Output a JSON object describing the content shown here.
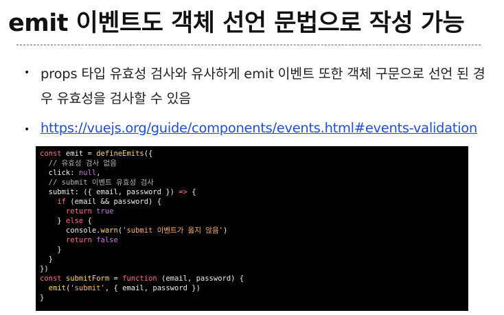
{
  "slide": {
    "title": "emit 이벤트도 객체 선언 문법으로 작성 가능",
    "bullets": [
      {
        "marker": "•",
        "text": "props 타입 유효성 검사와 유사하게 emit 이벤트 또한 객체 구문으로 선언 된 경우 유효성을 검사할 수 있음"
      },
      {
        "marker": "•",
        "link": "https://vuejs.org/guide/components/events.html#events-validation"
      }
    ]
  },
  "code": {
    "lines": [
      [
        [
          "kw",
          "const"
        ],
        [
          "pl",
          " emit = "
        ],
        [
          "fn",
          "defineEmits"
        ],
        [
          "pl",
          "({"
        ]
      ],
      [
        [
          "cm",
          "  // 유효성 검사 없음"
        ]
      ],
      [
        [
          "pl",
          "  click: "
        ],
        [
          "nul",
          "null"
        ],
        [
          "pl",
          ","
        ]
      ],
      [
        [
          "cm",
          "  // submit 이벤트 유효성 검사"
        ]
      ],
      [
        [
          "pl",
          "  submit: ({ email, password }) "
        ],
        [
          "kw",
          "=>"
        ],
        [
          "pl",
          " {"
        ]
      ],
      [
        [
          "kw",
          "    if"
        ],
        [
          "pl",
          " (email && password) {"
        ]
      ],
      [
        [
          "kw",
          "      return"
        ],
        [
          "pl",
          " "
        ],
        [
          "bool",
          "true"
        ]
      ],
      [
        [
          "pl",
          "    } "
        ],
        [
          "kw",
          "else"
        ],
        [
          "pl",
          " {"
        ]
      ],
      [
        [
          "pl",
          "      console."
        ],
        [
          "fn",
          "warn"
        ],
        [
          "pl",
          "("
        ],
        [
          "str",
          "'submit 이벤트가 옳지 않음'"
        ],
        [
          "pl",
          ")"
        ]
      ],
      [
        [
          "kw",
          "      return"
        ],
        [
          "pl",
          " "
        ],
        [
          "bool",
          "false"
        ]
      ],
      [
        [
          "pl",
          "    }"
        ]
      ],
      [
        [
          "pl",
          "  }"
        ]
      ],
      [
        [
          "pl",
          "})"
        ]
      ],
      [
        [
          "kw",
          "const"
        ],
        [
          "pl",
          " "
        ],
        [
          "fn",
          "submitForm"
        ],
        [
          "pl",
          " = "
        ],
        [
          "kw",
          "function"
        ],
        [
          "pl",
          " (email, password) {"
        ]
      ],
      [
        [
          "pl",
          "  "
        ],
        [
          "fn",
          "emit"
        ],
        [
          "pl",
          "("
        ],
        [
          "str",
          "'submit'"
        ],
        [
          "pl",
          ", { email, password })"
        ]
      ],
      [
        [
          "pl",
          "}"
        ]
      ]
    ]
  }
}
